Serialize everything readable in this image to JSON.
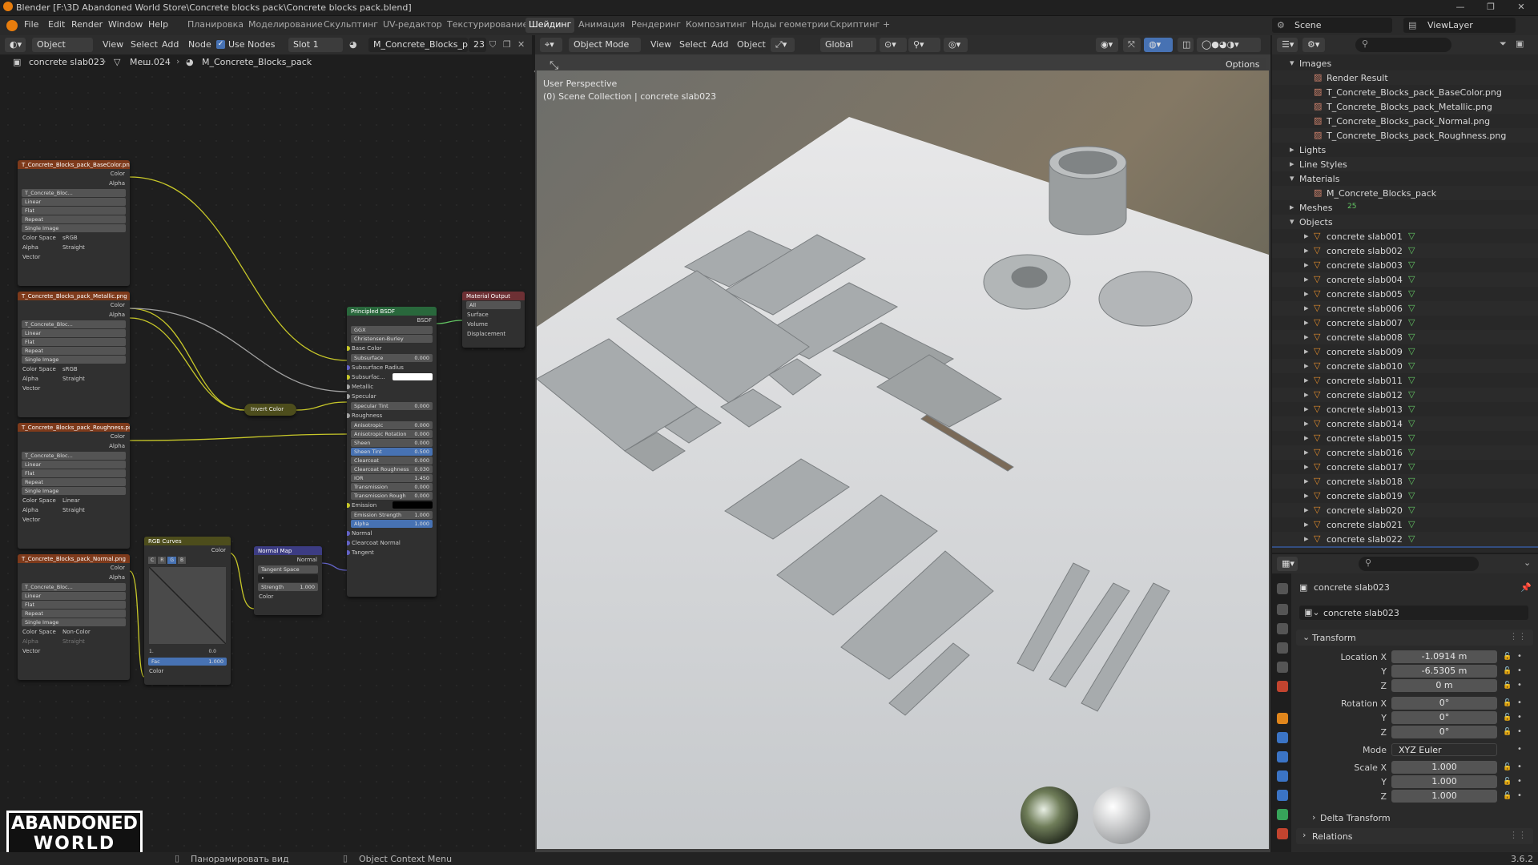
{
  "window": {
    "title": "Blender [F:\\3D Abandoned World Store\\Concrete blocks pack\\Concrete blocks pack.blend]"
  },
  "menu": {
    "items": [
      "File",
      "Edit",
      "Render",
      "Window",
      "Help"
    ],
    "workspaces": [
      "Планировка",
      "Моделирование",
      "Скульптинг",
      "UV-редактор",
      "Текстурирование",
      "Шейдинг",
      "Анимация",
      "Рендеринг",
      "Композитинг",
      "Ноды геометрии",
      "Скриптинг"
    ],
    "active_workspace": "Шейдинг",
    "add_workspace": "+",
    "scene": "Scene",
    "view_layer": "ViewLayer"
  },
  "node_editor": {
    "header": {
      "mode": "Object",
      "view": "View",
      "select": "Select",
      "add": "Add",
      "node": "Node",
      "use_nodes": "Use Nodes",
      "slot": "Slot 1",
      "material": "M_Concrete_Blocks_pack",
      "users": "23"
    },
    "breadcrumb": [
      "concrete slab023",
      "Меш.024",
      "M_Concrete_Blocks_pack"
    ],
    "image_nodes": [
      {
        "title": "T_Concrete_Blocks_pack_BaseColor.png",
        "image": "T_Concrete_Bloc...",
        "interp": "Linear",
        "proj": "Flat",
        "ext": "Repeat",
        "src": "Single Image",
        "color_space": "sRGB",
        "alpha": "Straight"
      },
      {
        "title": "T_Concrete_Blocks_pack_Metallic.png",
        "image": "T_Concrete_Bloc...",
        "interp": "Linear",
        "proj": "Flat",
        "ext": "Repeat",
        "src": "Single Image",
        "color_space": "sRGB",
        "alpha": "Straight"
      },
      {
        "title": "T_Concrete_Blocks_pack_Roughness.png",
        "image": "T_Concrete_Bloc...",
        "interp": "Linear",
        "proj": "Flat",
        "ext": "Repeat",
        "src": "Single Image",
        "color_space": "Linear",
        "alpha": "Straight"
      },
      {
        "title": "T_Concrete_Blocks_pack_Normal.png",
        "image": "T_Concrete_Bloc...",
        "interp": "Linear",
        "proj": "Flat",
        "ext": "Repeat",
        "src": "Single Image",
        "color_space": "Non-Color",
        "alpha": "Straight"
      }
    ],
    "socket_labels": {
      "color": "Color",
      "alpha": "Alpha",
      "vector": "Vector",
      "color_space": "Color Space",
      "alpha_lbl": "Alpha"
    },
    "invert": "Invert Color",
    "rgb_curves": {
      "title": "RGB Curves",
      "tabs": [
        "C",
        "R",
        "G",
        "B"
      ],
      "fac_label": "Fac",
      "fac": "1.000",
      "color": "Color",
      "out": "Color",
      "val": "0.0",
      "one": "1."
    },
    "normal_map": {
      "title": "Normal Map",
      "out": "Normal",
      "space": "Tangent Space",
      "strength_label": "Strength",
      "strength": "1.000",
      "color": "Color"
    },
    "bsdf": {
      "title": "Principled BSDF",
      "out": "BSDF",
      "dist": "GGX",
      "sss": "Christensen-Burley",
      "fields": [
        {
          "label": "Base Color",
          "kind": "sock"
        },
        {
          "label": "Subsurface",
          "value": "0.000",
          "kind": "field"
        },
        {
          "label": "Subsurface Radius",
          "kind": "drop"
        },
        {
          "label": "Subsurfac...",
          "kind": "white"
        },
        {
          "label": "Metallic",
          "kind": "sock"
        },
        {
          "label": "Specular",
          "kind": "sock"
        },
        {
          "label": "Specular Tint",
          "value": "0.000",
          "kind": "field"
        },
        {
          "label": "Roughness",
          "kind": "sock"
        },
        {
          "label": "Anisotropic",
          "value": "0.000",
          "kind": "field"
        },
        {
          "label": "Anisotropic Rotation",
          "value": "0.000",
          "kind": "field"
        },
        {
          "label": "Sheen",
          "value": "0.000",
          "kind": "field"
        },
        {
          "label": "Sheen Tint",
          "value": "0.500",
          "kind": "blue"
        },
        {
          "label": "Clearcoat",
          "value": "0.000",
          "kind": "field"
        },
        {
          "label": "Clearcoat Roughness",
          "value": "0.030",
          "kind": "field"
        },
        {
          "label": "IOR",
          "value": "1.450",
          "kind": "field"
        },
        {
          "label": "Transmission",
          "value": "0.000",
          "kind": "field"
        },
        {
          "label": "Transmission Rough",
          "value": "0.000",
          "kind": "field"
        },
        {
          "label": "Emission",
          "kind": "black"
        },
        {
          "label": "Emission Strength",
          "value": "1.000",
          "kind": "field"
        },
        {
          "label": "Alpha",
          "value": "1.000",
          "kind": "blue"
        },
        {
          "label": "Normal",
          "kind": "sock"
        },
        {
          "label": "Clearcoat Normal",
          "kind": "sock"
        },
        {
          "label": "Tangent",
          "kind": "sock"
        }
      ]
    },
    "output": {
      "title": "Material Output",
      "target": "All",
      "sockets": [
        "Surface",
        "Volume",
        "Displacement"
      ]
    }
  },
  "viewport": {
    "mode": "Object Mode",
    "view": "View",
    "select": "Select",
    "add": "Add",
    "object": "Object",
    "orientation": "Global",
    "options": "Options",
    "overlay1": "User Perspective",
    "overlay2": "(0) Scene Collection | concrete slab023"
  },
  "outliner": {
    "categories": [
      {
        "label": "Images",
        "open": true,
        "children": [
          "Render Result",
          "T_Concrete_Blocks_pack_BaseColor.png",
          "T_Concrete_Blocks_pack_Metallic.png",
          "T_Concrete_Blocks_pack_Normal.png",
          "T_Concrete_Blocks_pack_Roughness.png"
        ]
      },
      {
        "label": "Lights",
        "open": false
      },
      {
        "label": "Line Styles",
        "open": false
      },
      {
        "label": "Materials",
        "open": true,
        "children": [
          "M_Concrete_Blocks_pack"
        ]
      },
      {
        "label": "Meshes",
        "open": false,
        "badge": "25"
      },
      {
        "label": "Objects",
        "open": true
      }
    ],
    "objects": [
      "concrete slab001",
      "concrete slab002",
      "concrete slab003",
      "concrete slab004",
      "concrete slab005",
      "concrete slab006",
      "concrete slab007",
      "concrete slab008",
      "concrete slab009",
      "concrete slab010",
      "concrete slab011",
      "concrete slab012",
      "concrete slab013",
      "concrete slab014",
      "concrete slab015",
      "concrete slab016",
      "concrete slab017",
      "concrete slab018",
      "concrete slab019",
      "concrete slab020",
      "concrete slab021",
      "concrete slab022",
      "concrete slab023"
    ]
  },
  "properties": {
    "object": "concrete slab023",
    "datablock": "concrete slab023",
    "transform": "Transform",
    "location": {
      "label": "Location X",
      "x": "-1.0914 m",
      "y": "-6.5305 m",
      "z": "0 m"
    },
    "rotation": {
      "label": "Rotation X",
      "x": "0°",
      "y": "0°",
      "z": "0°"
    },
    "mode_label": "Mode",
    "mode": "XYZ Euler",
    "scale": {
      "label": "Scale X",
      "x": "1.000",
      "y": "1.000",
      "z": "1.000"
    },
    "axis": {
      "y": "Y",
      "z": "Z"
    },
    "delta": "Delta Transform",
    "relations": "Relations"
  },
  "status": {
    "left": "Панорамировать вид",
    "mid": "Object Context Menu",
    "version": "3.6.2"
  },
  "logo": {
    "line1": "ABANDONED",
    "line2": "WORLD"
  },
  "colors": {
    "accent": "#4772b3",
    "image_node": "#7e3a1b",
    "bsdf_node": "#29683c",
    "output_node": "#6d3034",
    "converter": "#4d4d1c",
    "vector_node": "#3c3c83"
  }
}
